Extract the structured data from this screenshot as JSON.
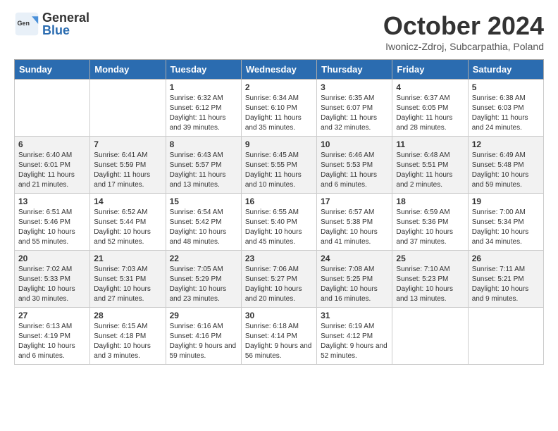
{
  "header": {
    "logo_general": "General",
    "logo_blue": "Blue",
    "month_title": "October 2024",
    "subtitle": "Iwonicz-Zdroj, Subcarpathia, Poland"
  },
  "days_of_week": [
    "Sunday",
    "Monday",
    "Tuesday",
    "Wednesday",
    "Thursday",
    "Friday",
    "Saturday"
  ],
  "weeks": [
    [
      {
        "day": "",
        "content": ""
      },
      {
        "day": "",
        "content": ""
      },
      {
        "day": "1",
        "content": "Sunrise: 6:32 AM\nSunset: 6:12 PM\nDaylight: 11 hours and 39 minutes."
      },
      {
        "day": "2",
        "content": "Sunrise: 6:34 AM\nSunset: 6:10 PM\nDaylight: 11 hours and 35 minutes."
      },
      {
        "day": "3",
        "content": "Sunrise: 6:35 AM\nSunset: 6:07 PM\nDaylight: 11 hours and 32 minutes."
      },
      {
        "day": "4",
        "content": "Sunrise: 6:37 AM\nSunset: 6:05 PM\nDaylight: 11 hours and 28 minutes."
      },
      {
        "day": "5",
        "content": "Sunrise: 6:38 AM\nSunset: 6:03 PM\nDaylight: 11 hours and 24 minutes."
      }
    ],
    [
      {
        "day": "6",
        "content": "Sunrise: 6:40 AM\nSunset: 6:01 PM\nDaylight: 11 hours and 21 minutes."
      },
      {
        "day": "7",
        "content": "Sunrise: 6:41 AM\nSunset: 5:59 PM\nDaylight: 11 hours and 17 minutes."
      },
      {
        "day": "8",
        "content": "Sunrise: 6:43 AM\nSunset: 5:57 PM\nDaylight: 11 hours and 13 minutes."
      },
      {
        "day": "9",
        "content": "Sunrise: 6:45 AM\nSunset: 5:55 PM\nDaylight: 11 hours and 10 minutes."
      },
      {
        "day": "10",
        "content": "Sunrise: 6:46 AM\nSunset: 5:53 PM\nDaylight: 11 hours and 6 minutes."
      },
      {
        "day": "11",
        "content": "Sunrise: 6:48 AM\nSunset: 5:51 PM\nDaylight: 11 hours and 2 minutes."
      },
      {
        "day": "12",
        "content": "Sunrise: 6:49 AM\nSunset: 5:48 PM\nDaylight: 10 hours and 59 minutes."
      }
    ],
    [
      {
        "day": "13",
        "content": "Sunrise: 6:51 AM\nSunset: 5:46 PM\nDaylight: 10 hours and 55 minutes."
      },
      {
        "day": "14",
        "content": "Sunrise: 6:52 AM\nSunset: 5:44 PM\nDaylight: 10 hours and 52 minutes."
      },
      {
        "day": "15",
        "content": "Sunrise: 6:54 AM\nSunset: 5:42 PM\nDaylight: 10 hours and 48 minutes."
      },
      {
        "day": "16",
        "content": "Sunrise: 6:55 AM\nSunset: 5:40 PM\nDaylight: 10 hours and 45 minutes."
      },
      {
        "day": "17",
        "content": "Sunrise: 6:57 AM\nSunset: 5:38 PM\nDaylight: 10 hours and 41 minutes."
      },
      {
        "day": "18",
        "content": "Sunrise: 6:59 AM\nSunset: 5:36 PM\nDaylight: 10 hours and 37 minutes."
      },
      {
        "day": "19",
        "content": "Sunrise: 7:00 AM\nSunset: 5:34 PM\nDaylight: 10 hours and 34 minutes."
      }
    ],
    [
      {
        "day": "20",
        "content": "Sunrise: 7:02 AM\nSunset: 5:33 PM\nDaylight: 10 hours and 30 minutes."
      },
      {
        "day": "21",
        "content": "Sunrise: 7:03 AM\nSunset: 5:31 PM\nDaylight: 10 hours and 27 minutes."
      },
      {
        "day": "22",
        "content": "Sunrise: 7:05 AM\nSunset: 5:29 PM\nDaylight: 10 hours and 23 minutes."
      },
      {
        "day": "23",
        "content": "Sunrise: 7:06 AM\nSunset: 5:27 PM\nDaylight: 10 hours and 20 minutes."
      },
      {
        "day": "24",
        "content": "Sunrise: 7:08 AM\nSunset: 5:25 PM\nDaylight: 10 hours and 16 minutes."
      },
      {
        "day": "25",
        "content": "Sunrise: 7:10 AM\nSunset: 5:23 PM\nDaylight: 10 hours and 13 minutes."
      },
      {
        "day": "26",
        "content": "Sunrise: 7:11 AM\nSunset: 5:21 PM\nDaylight: 10 hours and 9 minutes."
      }
    ],
    [
      {
        "day": "27",
        "content": "Sunrise: 6:13 AM\nSunset: 4:19 PM\nDaylight: 10 hours and 6 minutes."
      },
      {
        "day": "28",
        "content": "Sunrise: 6:15 AM\nSunset: 4:18 PM\nDaylight: 10 hours and 3 minutes."
      },
      {
        "day": "29",
        "content": "Sunrise: 6:16 AM\nSunset: 4:16 PM\nDaylight: 9 hours and 59 minutes."
      },
      {
        "day": "30",
        "content": "Sunrise: 6:18 AM\nSunset: 4:14 PM\nDaylight: 9 hours and 56 minutes."
      },
      {
        "day": "31",
        "content": "Sunrise: 6:19 AM\nSunset: 4:12 PM\nDaylight: 9 hours and 52 minutes."
      },
      {
        "day": "",
        "content": ""
      },
      {
        "day": "",
        "content": ""
      }
    ]
  ]
}
